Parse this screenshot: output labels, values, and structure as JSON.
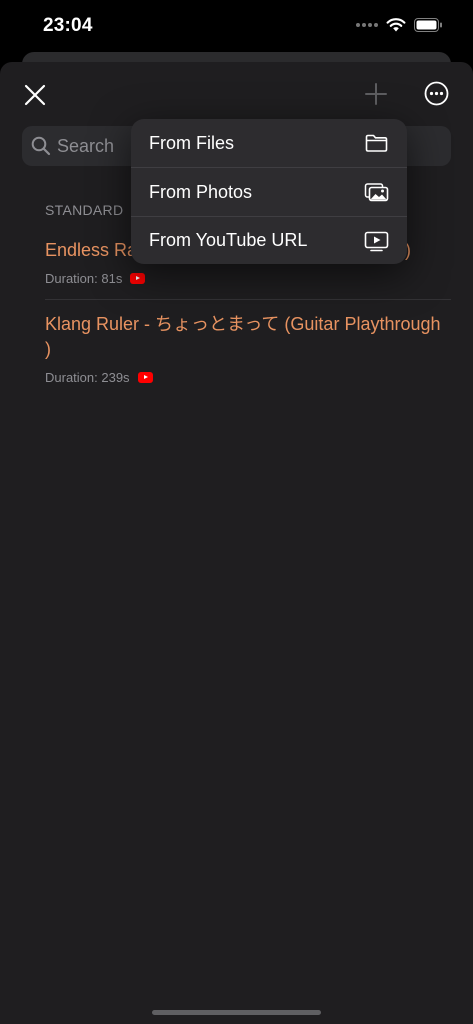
{
  "status_bar": {
    "time": "23:04"
  },
  "search": {
    "placeholder": "Search"
  },
  "section": {
    "title": "STANDARD"
  },
  "items": [
    {
      "title": "Endless Ra",
      "title_end": "k)",
      "duration": "Duration: 81s",
      "source_icon": "youtube-icon"
    },
    {
      "title": "Klang Ruler - ちょっとまって (Guitar Playthrough )",
      "duration": "Duration: 239s",
      "source_icon": "youtube-icon"
    }
  ],
  "menu": {
    "items": [
      {
        "label": "From Files",
        "icon": "folder-icon"
      },
      {
        "label": "From Photos",
        "icon": "photos-icon"
      },
      {
        "label": "From YouTube URL",
        "icon": "video-screen-icon"
      }
    ]
  },
  "colors": {
    "accent": "#e89361",
    "background": "#1f1e20",
    "menu_background": "#2d2c2f",
    "youtube_red": "#ff0000"
  }
}
